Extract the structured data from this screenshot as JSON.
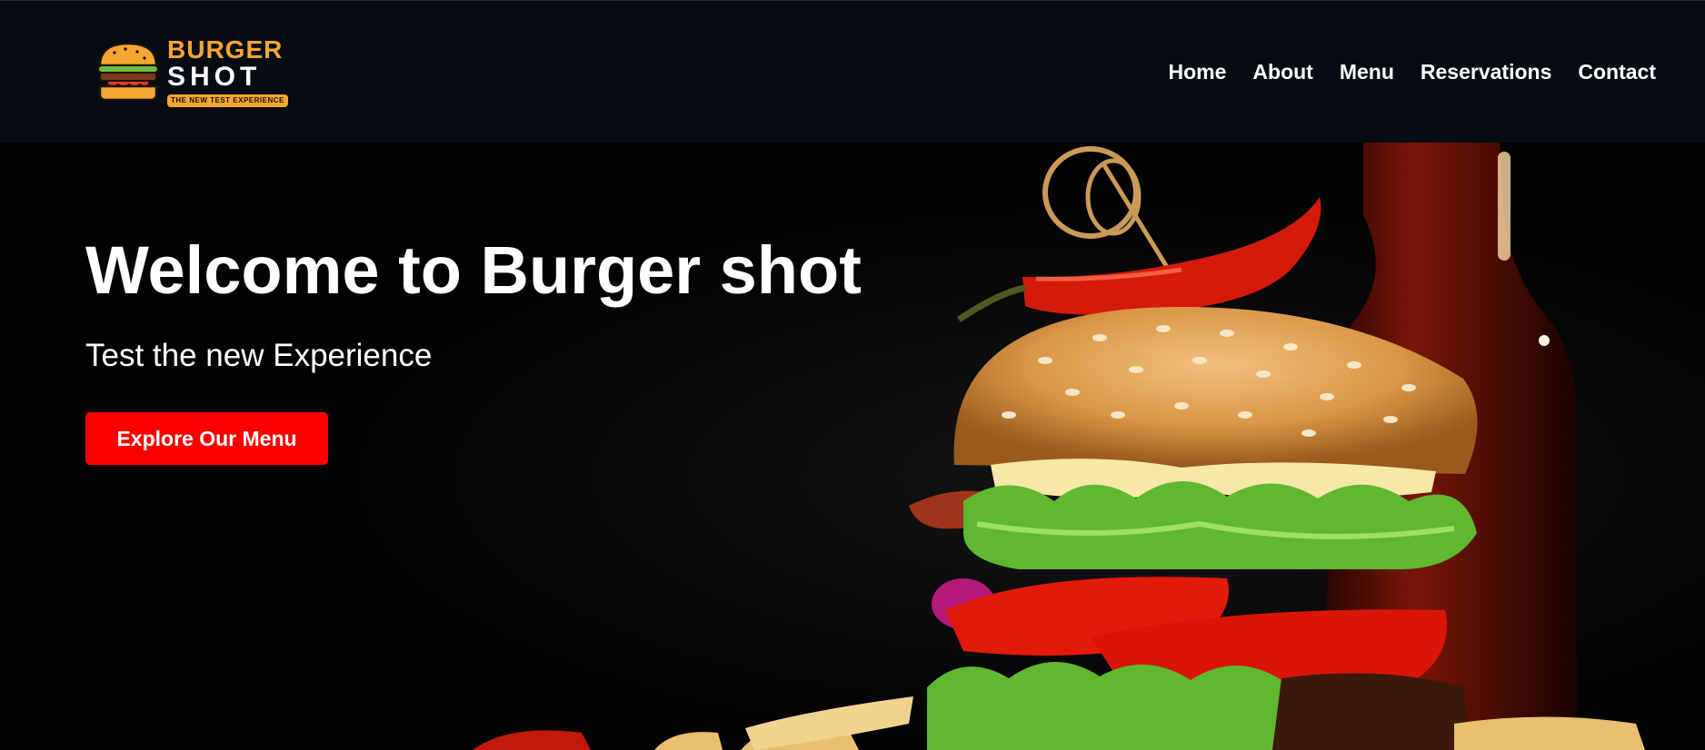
{
  "brand": {
    "name_line1": "BURGER",
    "name_line2": "SHOT",
    "tagline": "THE NEW TEST EXPERIENCE",
    "logo_icon": "burger-icon",
    "colors": {
      "accent": "#f5a630",
      "nav_bg": "#070b12"
    }
  },
  "nav": {
    "items": [
      {
        "label": "Home"
      },
      {
        "label": "About"
      },
      {
        "label": "Menu"
      },
      {
        "label": "Reservations"
      },
      {
        "label": "Contact"
      }
    ]
  },
  "hero": {
    "title": "Welcome to Burger shot",
    "subtitle": "Test the new Experience",
    "cta_label": "Explore Our Menu",
    "cta_color": "#fb0000",
    "image": "burger-photo"
  }
}
